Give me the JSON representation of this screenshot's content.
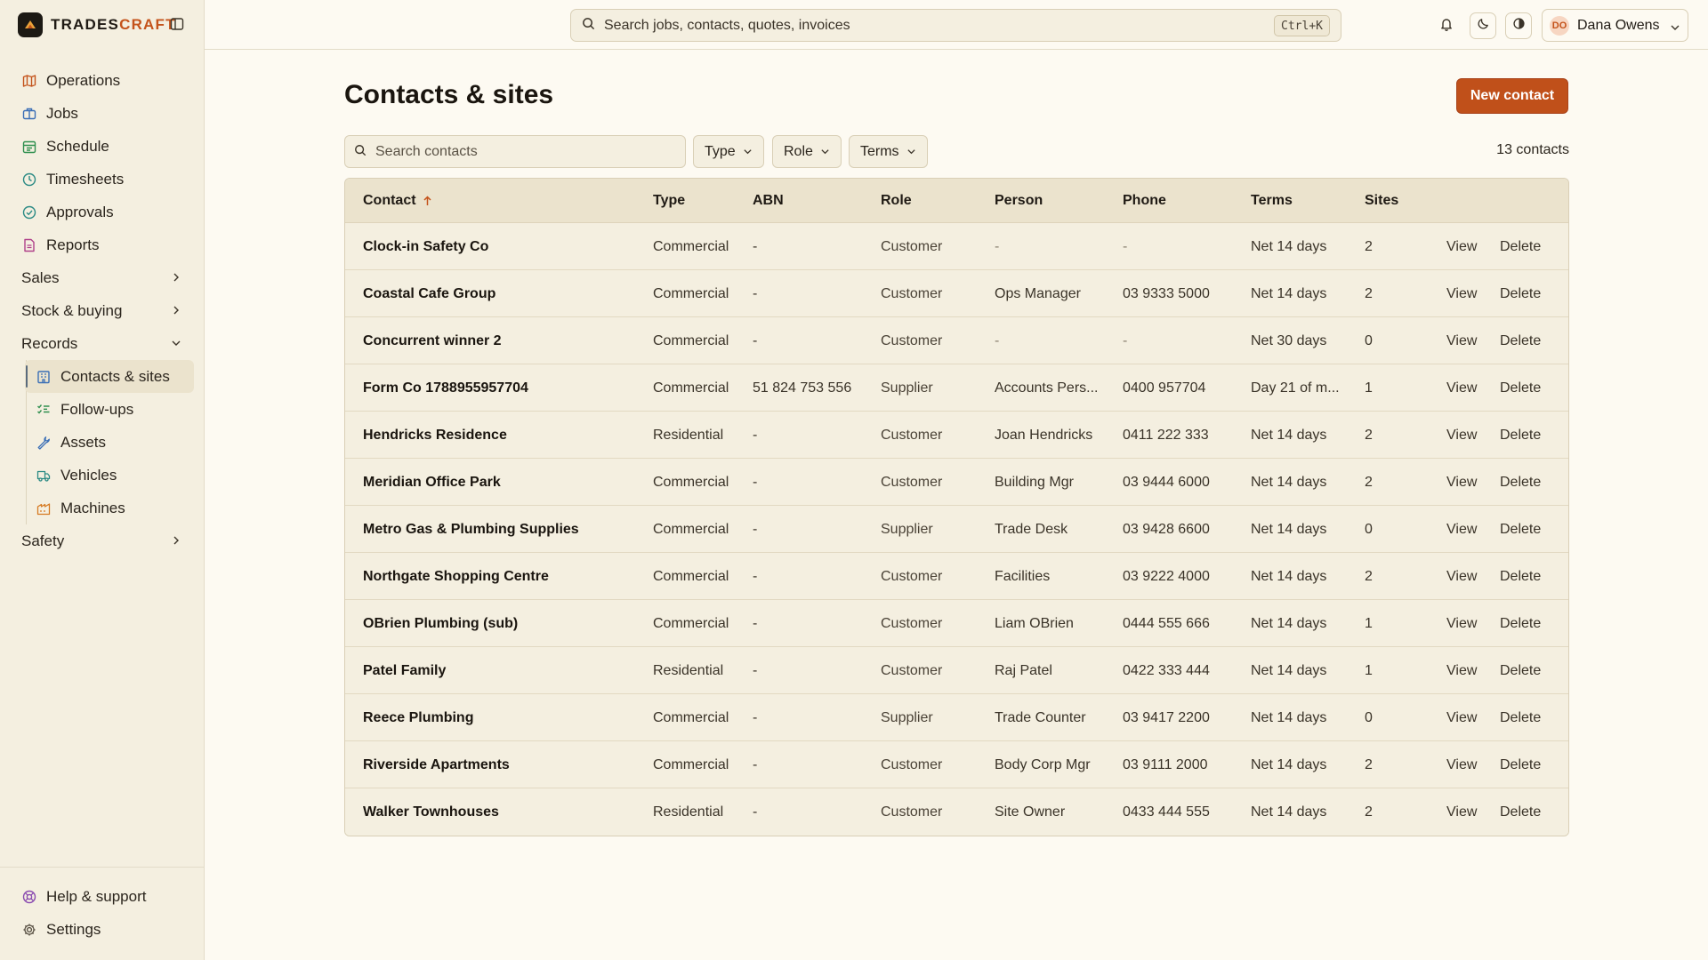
{
  "brand": {
    "name_a": "TRADES",
    "name_b": "CRAFT"
  },
  "nav": {
    "items": [
      {
        "label": "Operations",
        "icon": "map-icon",
        "color": "#c4531b"
      },
      {
        "label": "Jobs",
        "icon": "briefcase-icon",
        "color": "#3b6fb6"
      },
      {
        "label": "Schedule",
        "icon": "calendar-icon",
        "color": "#2f8f4e"
      },
      {
        "label": "Timesheets",
        "icon": "clock-icon",
        "color": "#2a8a84"
      },
      {
        "label": "Approvals",
        "icon": "check-circle-icon",
        "color": "#2a8a84"
      },
      {
        "label": "Reports",
        "icon": "report-icon",
        "color": "#b0418a"
      }
    ],
    "groups": {
      "sales": "Sales",
      "stock": "Stock & buying",
      "records": "Records",
      "safety": "Safety"
    },
    "records_items": [
      {
        "label": "Contacts & sites",
        "icon": "building-icon",
        "color": "#3b6fb6"
      },
      {
        "label": "Follow-ups",
        "icon": "list-check-icon",
        "color": "#2f8f4e"
      },
      {
        "label": "Assets",
        "icon": "wrench-icon",
        "color": "#3b6fb6"
      },
      {
        "label": "Vehicles",
        "icon": "truck-icon",
        "color": "#2a8a84"
      },
      {
        "label": "Machines",
        "icon": "machine-icon",
        "color": "#d67a22"
      }
    ],
    "bottom": [
      {
        "label": "Help & support",
        "icon": "lifebuoy-icon",
        "color": "#8a4bb0"
      },
      {
        "label": "Settings",
        "icon": "gear-icon",
        "color": "#5a5245"
      }
    ]
  },
  "topbar": {
    "search_placeholder": "Search jobs, contacts, quotes, invoices",
    "shortcut": "Ctrl+K",
    "user_initials": "DO",
    "user_name": "Dana Owens"
  },
  "page": {
    "title": "Contacts & sites",
    "new_button": "New contact",
    "search_placeholder": "Search contacts",
    "filters": [
      "Type",
      "Role",
      "Terms"
    ],
    "count": "13 contacts"
  },
  "table": {
    "columns": [
      "Contact",
      "Type",
      "ABN",
      "Role",
      "Person",
      "Phone",
      "Terms",
      "Sites"
    ],
    "view_label": "View",
    "delete_label": "Delete",
    "rows": [
      [
        "Clock-in Safety Co",
        "Commercial",
        "-",
        "Customer",
        "-",
        "-",
        "Net 14 days",
        "2"
      ],
      [
        "Coastal Cafe Group",
        "Commercial",
        "-",
        "Customer",
        "Ops Manager",
        "03 9333 5000",
        "Net 14 days",
        "2"
      ],
      [
        "Concurrent winner 2",
        "Commercial",
        "-",
        "Customer",
        "-",
        "-",
        "Net 30 days",
        "0"
      ],
      [
        "Form Co 1788955957704",
        "Commercial",
        "51 824 753 556",
        "Supplier",
        "Accounts Pers...",
        "0400 957704",
        "Day 21 of m...",
        "1"
      ],
      [
        "Hendricks Residence",
        "Residential",
        "-",
        "Customer",
        "Joan Hendricks",
        "0411 222 333",
        "Net 14 days",
        "2"
      ],
      [
        "Meridian Office Park",
        "Commercial",
        "-",
        "Customer",
        "Building Mgr",
        "03 9444 6000",
        "Net 14 days",
        "2"
      ],
      [
        "Metro Gas & Plumbing Supplies",
        "Commercial",
        "-",
        "Supplier",
        "Trade Desk",
        "03 9428 6600",
        "Net 14 days",
        "0"
      ],
      [
        "Northgate Shopping Centre",
        "Commercial",
        "-",
        "Customer",
        "Facilities",
        "03 9222 4000",
        "Net 14 days",
        "2"
      ],
      [
        "OBrien Plumbing (sub)",
        "Commercial",
        "-",
        "Customer",
        "Liam OBrien",
        "0444 555 666",
        "Net 14 days",
        "1"
      ],
      [
        "Patel Family",
        "Residential",
        "-",
        "Customer",
        "Raj Patel",
        "0422 333 444",
        "Net 14 days",
        "1"
      ],
      [
        "Reece Plumbing",
        "Commercial",
        "-",
        "Supplier",
        "Trade Counter",
        "03 9417 2200",
        "Net 14 days",
        "0"
      ],
      [
        "Riverside Apartments",
        "Commercial",
        "-",
        "Customer",
        "Body Corp Mgr",
        "03 9111 2000",
        "Net 14 days",
        "2"
      ],
      [
        "Walker Townhouses",
        "Residential",
        "-",
        "Customer",
        "Site Owner",
        "0433 444 555",
        "Net 14 days",
        "2"
      ]
    ]
  }
}
